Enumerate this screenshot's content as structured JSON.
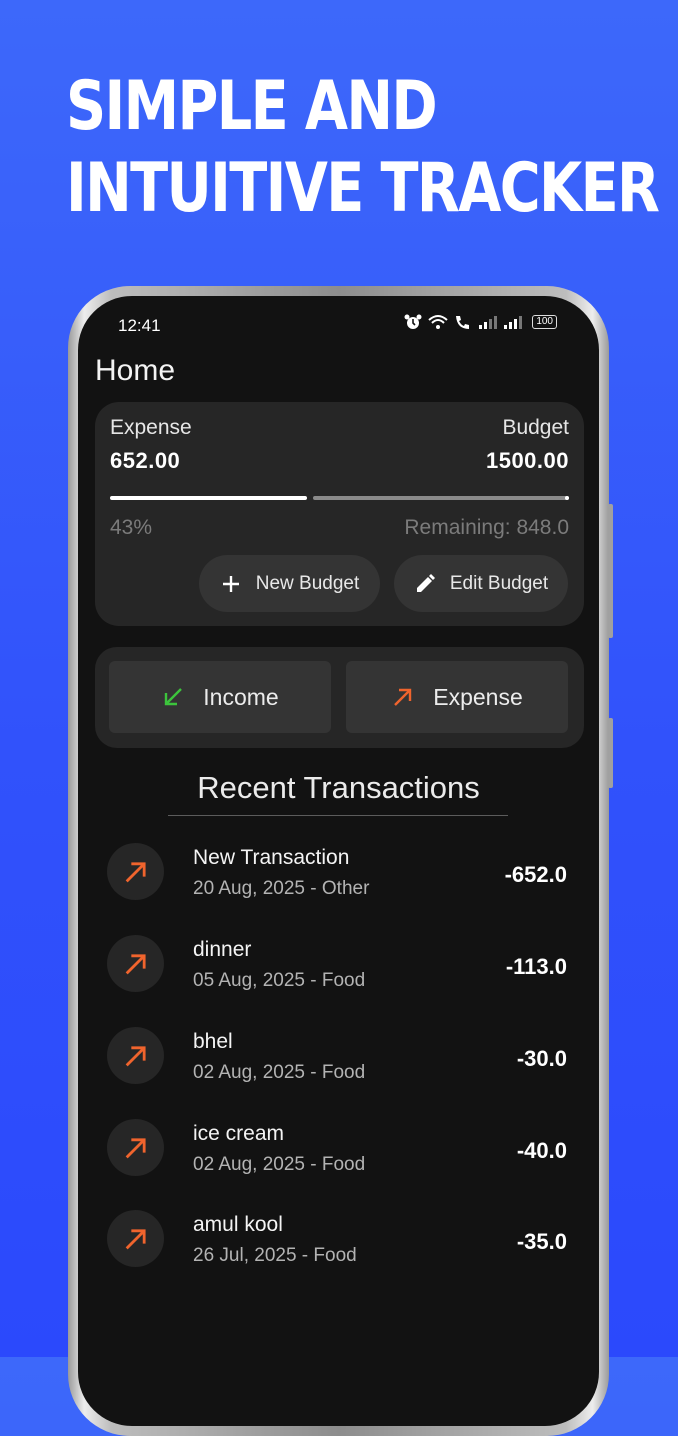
{
  "headline": {
    "line1": "SIMPLE AND",
    "line2": "INTUITIVE TRACKER"
  },
  "status_bar": {
    "time": "12:41",
    "battery": "100",
    "icons": [
      "alarm-icon",
      "wifi-icon",
      "call-icon",
      "signal-icon",
      "signal-icon",
      "battery-icon"
    ]
  },
  "page_title": "Home",
  "budget_card": {
    "expense_label": "Expense",
    "expense_value": "652.00",
    "budget_label": "Budget",
    "budget_value": "1500.00",
    "progress_fraction": 0.43,
    "percent_text": "43%",
    "remaining_text": "Remaining: 848.0",
    "new_budget_label": "New Budget",
    "edit_budget_label": "Edit Budget"
  },
  "actions": {
    "income_label": "Income",
    "expense_label": "Expense",
    "income_color": "#3cc43c",
    "expense_color": "#f0642d"
  },
  "recent": {
    "title": "Recent Transactions",
    "transactions": [
      {
        "name": "New Transaction",
        "meta": "20 Aug, 2025 - Other",
        "amount": "-652.0",
        "icon": "arrow-up-right-icon"
      },
      {
        "name": "dinner",
        "meta": "05 Aug, 2025 - Food",
        "amount": "-113.0",
        "icon": "arrow-up-right-icon"
      },
      {
        "name": "bhel",
        "meta": "02 Aug, 2025 - Food",
        "amount": "-30.0",
        "icon": "arrow-up-right-icon"
      },
      {
        "name": "ice cream",
        "meta": "02 Aug, 2025 - Food",
        "amount": "-40.0",
        "icon": "arrow-up-right-icon"
      },
      {
        "name": "amul kool",
        "meta": "26 Jul, 2025 - Food",
        "amount": "-35.0",
        "icon": "arrow-up-right-icon"
      }
    ]
  },
  "colors": {
    "background_top": "#3d68fa",
    "background_bottom": "#2b49fc",
    "screen": "#121212",
    "card": "#262626",
    "expense_arrow": "#f0642d",
    "income_arrow": "#3cc43c"
  }
}
